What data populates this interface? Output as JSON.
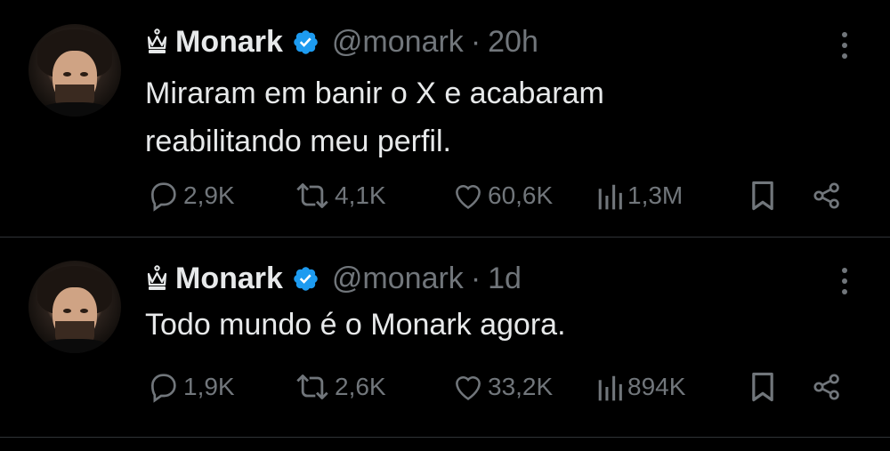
{
  "tweets": [
    {
      "display_name": "Monark",
      "handle": "@monark",
      "separator": "·",
      "time": "20h",
      "text_lines": [
        "Miraram em banir o X e acabaram",
        "reabilitando meu perfil."
      ],
      "stats": {
        "replies": "2,9K",
        "reposts": "4,1K",
        "likes": "60,6K",
        "views": "1,3M"
      }
    },
    {
      "display_name": "Monark",
      "handle": "@monark",
      "separator": "·",
      "time": "1d",
      "text_lines": [
        "Todo mundo é o Monark agora."
      ],
      "stats": {
        "replies": "1,9K",
        "reposts": "2,6K",
        "likes": "33,2K",
        "views": "894K"
      }
    }
  ],
  "colors": {
    "background": "#000000",
    "primary_text": "#e7e9ea",
    "secondary_text": "#71767b",
    "verified_blue": "#1d9bf0",
    "divider": "#2f3336"
  },
  "icons": [
    "crown-icon",
    "verified-badge-icon",
    "more-icon",
    "reply-icon",
    "repost-icon",
    "like-icon",
    "views-icon",
    "bookmark-icon",
    "share-icon"
  ]
}
